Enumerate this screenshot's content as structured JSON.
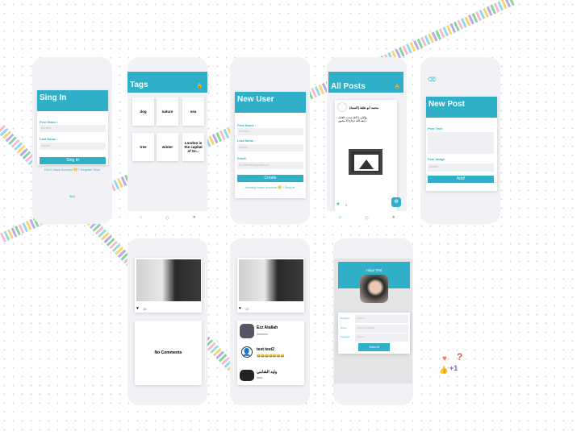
{
  "accent": "#2fb0c8",
  "signin": {
    "title": "Sing In",
    "first_label": "First Name :",
    "first_ph": "Ezzdine",
    "last_label": "Last Name :",
    "last_ph": "Atallah",
    "button": "Sing In",
    "register": "Don't Have Account 😁? Register Now",
    "skip": "Skip"
  },
  "tags": {
    "title": "Tags",
    "items": [
      "dog",
      "nature",
      "sea",
      "tree",
      "winter",
      "London is the capital of Gr..."
    ]
  },
  "newuser": {
    "title": "New User",
    "first_label": "First Name :",
    "first_ph": "Ezzdine",
    "last_label": "Last Name :",
    "last_ph": "Atallah",
    "email_label": "Email:",
    "email_ph": "Ezzdine486@gmail.com",
    "button": "Create",
    "signin": "Already Have Account 😁? Sing In"
  },
  "allposts": {
    "title": "All Posts",
    "author": "محمد ابو طقة (السنة)",
    "text": "واللي يا الله سدت القلب إيقه الله ترتاح إلا مجبور...",
    "likes": "0"
  },
  "newpost": {
    "title": "New Post",
    "text_label": "Post Text:",
    "image_label": "Post Image",
    "image_ph": "Atallah",
    "button": "Add!"
  },
  "post1": {
    "likes": "16",
    "empty": "No Comments"
  },
  "post2": {
    "likes": "10",
    "comments": [
      {
        "name": "Ezz Atallah",
        "text": "hmmmm"
      },
      {
        "name": "test test2",
        "text": "😂😂😂😂😂😂😂"
      },
      {
        "name": "وليد الشامي",
        "text": "wow"
      }
    ]
  },
  "profile": {
    "name": "Haya Test",
    "fields": [
      {
        "label": "FirstName",
        "value": "ezzdine"
      },
      {
        "label": "Phone",
        "value": "+962345345658"
      },
      {
        "label": "Password",
        "value": "Hiqsq2"
      }
    ],
    "button": "Submit"
  }
}
